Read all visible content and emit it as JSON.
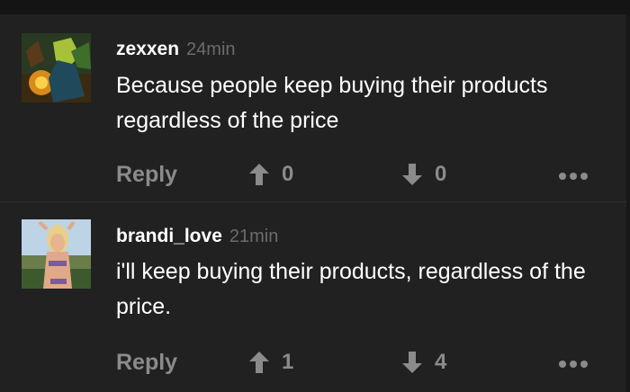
{
  "comments": [
    {
      "username": "zexxen",
      "time": "24min",
      "text": "Because people keep buying their products regardless of the price",
      "reply_label": "Reply",
      "upvotes": "0",
      "downvotes": "0"
    },
    {
      "username": "brandi_love",
      "time": "21min",
      "text": "i'll keep buying their products, regardless of the price.",
      "reply_label": "Reply",
      "upvotes": "1",
      "downvotes": "4"
    }
  ],
  "colors": {
    "background": "#212121",
    "text_primary": "#ffffff",
    "text_muted": "#8b8b8b",
    "timestamp": "#6c6c6c"
  },
  "icons": {
    "upvote": "arrow-up-icon",
    "downvote": "arrow-down-icon",
    "more": "more-dots-icon"
  }
}
